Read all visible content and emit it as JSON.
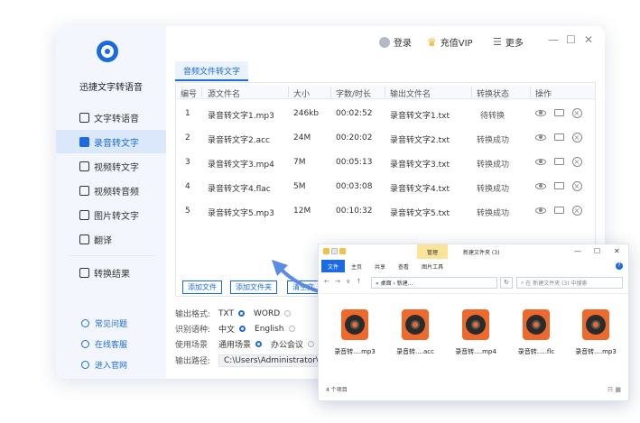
{
  "app": {
    "title": "迅捷文字转语音",
    "sidebar": [
      {
        "label": "文字转语音"
      },
      {
        "label": "录音转文字"
      },
      {
        "label": "视频转文字"
      },
      {
        "label": "视频转音频"
      },
      {
        "label": "图片转文字"
      },
      {
        "label": "翻译"
      }
    ],
    "results_label": "转换结果",
    "bottom_links": [
      "常见问题",
      "在线客服",
      "进入官网"
    ],
    "top": {
      "login": "登录",
      "vip": "充值VIP",
      "more": "更多"
    },
    "tab": "音频文件转文字",
    "headers": [
      "编号",
      "源文件名",
      "大小",
      "字数/时长",
      "输出文件名",
      "转换状态",
      "操作"
    ],
    "rows": [
      {
        "no": "1",
        "src": "录音转文字1.mp3",
        "size": "246kb",
        "duration": "00:02:52",
        "out": "录音转文字1.txt",
        "status": "待转换"
      },
      {
        "no": "2",
        "src": "录音转文字2.acc",
        "size": "24M",
        "duration": "00:20:02",
        "out": "录音转文字2.txt",
        "status": "转换成功"
      },
      {
        "no": "3",
        "src": "录音转文字3.mp4",
        "size": "7M",
        "duration": "00:05:13",
        "out": "录音转文字3.txt",
        "status": "转换成功"
      },
      {
        "no": "4",
        "src": "录音转文字4.flac",
        "size": "5M",
        "duration": "00:03:08",
        "out": "录音转文字4.txt",
        "status": "转换成功"
      },
      {
        "no": "5",
        "src": "录音转文字5.mp3",
        "size": "12M",
        "duration": "00:10:32",
        "out": "录音转文字5.txt",
        "status": "转换成功"
      }
    ],
    "buttons": [
      "添加文件",
      "添加文件夹",
      "清空文"
    ],
    "options": {
      "format_label": "输出格式:",
      "format_a": "TXT",
      "format_b": "WORD",
      "lang_label": "识别语种:",
      "lang_a": "中文",
      "lang_b": "English",
      "scene_label": "使用场景",
      "scene_a": "通用场景",
      "scene_b": "办公会议",
      "path_label": "输出路径:",
      "path_value": "C:\\Users\\Administrator\\D"
    }
  },
  "explorer": {
    "manage": "管理",
    "folder_name": "新建文件夹 (3)",
    "ribbon": [
      "文件",
      "主页",
      "共享",
      "查看",
      "图片工具"
    ],
    "address": "« 桌面 › 新建...",
    "search_placeholder": "在 新建文件夹 (3) 中搜索",
    "files": [
      "录音转....mp3",
      "录音转....acc",
      "录音转....mp4",
      "录音转.....flc",
      "录音转....mp3"
    ],
    "status": "4 个项目"
  },
  "colors": {
    "accent": "#1a6be0",
    "sidebar_bg": "#f3f7fd",
    "file_icon": "#ee6a2c"
  }
}
